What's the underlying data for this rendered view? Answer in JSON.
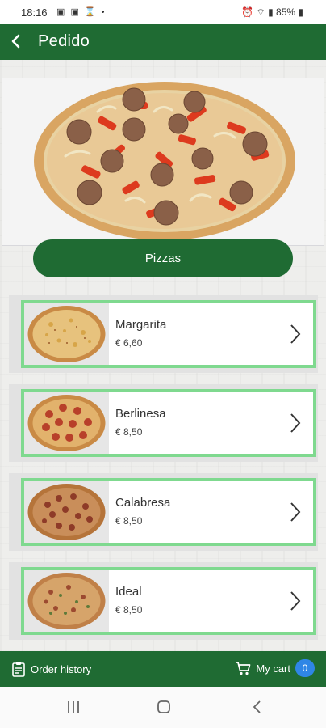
{
  "status_bar": {
    "time": "18:16",
    "battery": "85%"
  },
  "header": {
    "title": "Pedido"
  },
  "category_button": {
    "label": "Pizzas"
  },
  "products": [
    {
      "name": "Margarita",
      "price": "€ 6,60"
    },
    {
      "name": "Berlinesa",
      "price": "€ 8,50"
    },
    {
      "name": "Calabresa",
      "price": "€ 8,50"
    },
    {
      "name": "Ideal",
      "price": "€ 8,50"
    }
  ],
  "bottom_bar": {
    "order_history": "Order history",
    "my_cart": "My cart",
    "cart_count": "0"
  },
  "colors": {
    "primary": "#1f6b33",
    "card_border": "#7fd98f",
    "badge": "#2f86e6"
  }
}
